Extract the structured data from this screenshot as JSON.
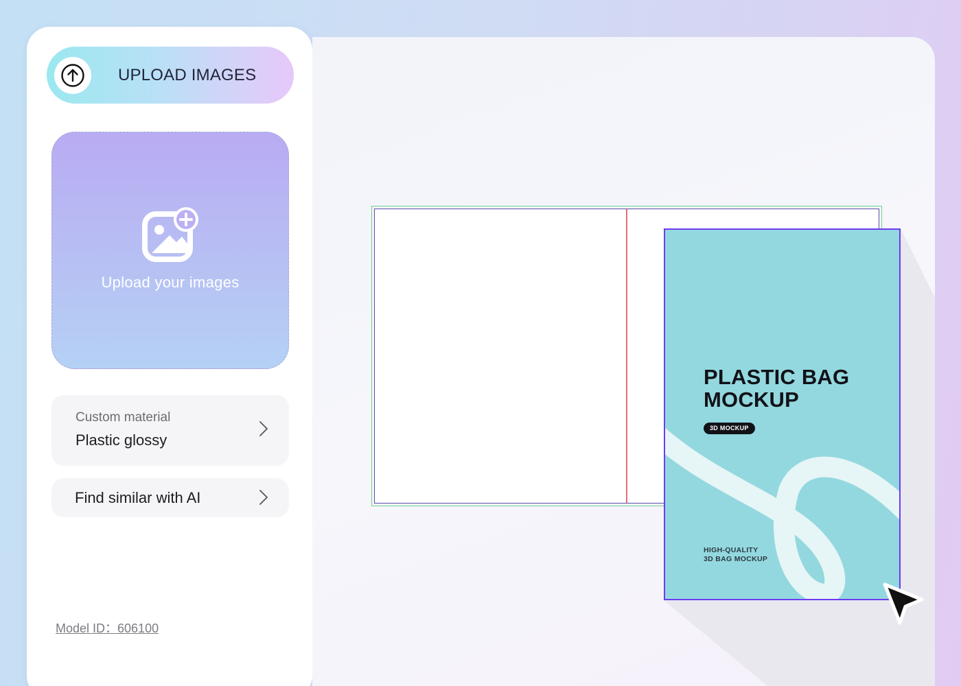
{
  "sidebar": {
    "upload_button_label": "UPLOAD IMAGES",
    "upload_icon": "arrow-up-circle-icon",
    "dropzone_text": "Upload your images",
    "dropzone_icon": "add-image-icon",
    "material": {
      "label": "Custom material",
      "value": "Plastic glossy"
    },
    "find_similar_label": "Find similar with AI",
    "model_id": "Model ID：606100"
  },
  "canvas": {
    "bag": {
      "title": "PLASTIC BAG MOCKUP",
      "badge": "3D MOCKUP",
      "tagline_line1": "HIGH-QUALITY",
      "tagline_line2": "3D BAG MOCKUP"
    }
  },
  "colors": {
    "bag_fill": "#94d8df",
    "bag_outline": "#6d3bf0",
    "dieline_outer": "#6fd08a",
    "fold_line": "#f06a74"
  }
}
